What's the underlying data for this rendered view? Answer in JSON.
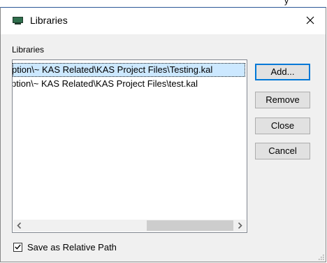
{
  "dialog": {
    "title": "Libraries",
    "group_label": "Libraries",
    "libraries": [
      "ption\\~ KAS Related\\KAS Project Files\\Testing.kal",
      "ption\\~ KAS Related\\KAS Project Files\\test.kal"
    ],
    "buttons": {
      "add": "Add...",
      "remove": "Remove",
      "close": "Close",
      "cancel": "Cancel"
    },
    "checkbox": {
      "label": "Save as Relative Path",
      "checked": true
    }
  },
  "background_text": "y",
  "colors": {
    "selection": "#cce8ff",
    "default_button_border": "#0078d7",
    "dialog_bg": "#f0f0f0"
  }
}
